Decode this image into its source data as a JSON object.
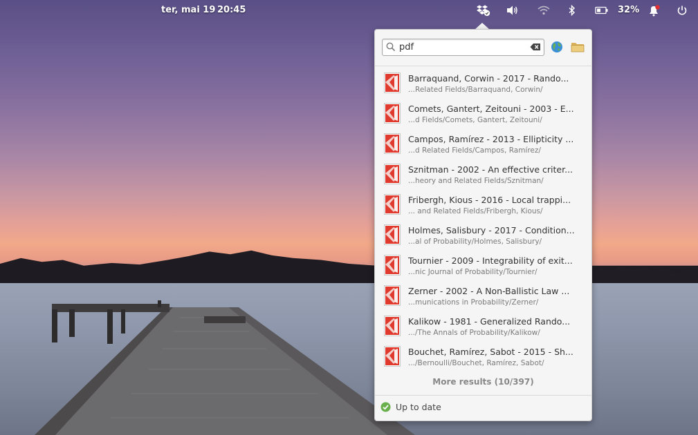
{
  "panel": {
    "date": "ter, mai 19",
    "time": "20:45",
    "battery_percent": "32%",
    "indicators": [
      "dropbox-icon",
      "volume-icon",
      "wifi-icon",
      "bluetooth-icon",
      "battery-icon",
      "notification-icon",
      "power-icon"
    ]
  },
  "popover": {
    "search": {
      "value": "pdf"
    },
    "results": [
      {
        "name": "Barraquand, Corwin - 2017 - Rando...",
        "path": "...Related Fields/Barraquand, Corwin/"
      },
      {
        "name": "Comets, Gantert, Zeitouni - 2003 - E...",
        "path": "...d Fields/Comets, Gantert, Zeitouni/"
      },
      {
        "name": "Campos, Ramírez - 2013 - Ellipticity ...",
        "path": "...d Related Fields/Campos, Ramírez/"
      },
      {
        "name": "Sznitman - 2002 - An effective criter...",
        "path": "...heory and Related Fields/Sznitman/"
      },
      {
        "name": "Fribergh, Kious - 2016 - Local trappi...",
        "path": "... and Related Fields/Fribergh, Kious/"
      },
      {
        "name": "Holmes, Salisbury - 2017 - Condition...",
        "path": "...al of Probability/Holmes, Salisbury/"
      },
      {
        "name": "Tournier - 2009 - Integrability of exit...",
        "path": "...nic Journal of Probability/Tournier/"
      },
      {
        "name": "Zerner - 2002 - A Non-Ballistic Law ...",
        "path": "...munications in Probability/Zerner/"
      },
      {
        "name": "Kalikow - 1981 - Generalized Rando...",
        "path": ".../The Annals of Probability/Kalikow/"
      },
      {
        "name": "Bouchet, Ramírez, Sabot - 2015 - Sh...",
        "path": ".../Bernoulli/Bouchet, Ramírez, Sabot/"
      }
    ],
    "more_results": "More results (10/397)",
    "status": "Up to date"
  },
  "colors": {
    "accent_green": "#6ab04c",
    "pdf_red": "#d9302c"
  }
}
